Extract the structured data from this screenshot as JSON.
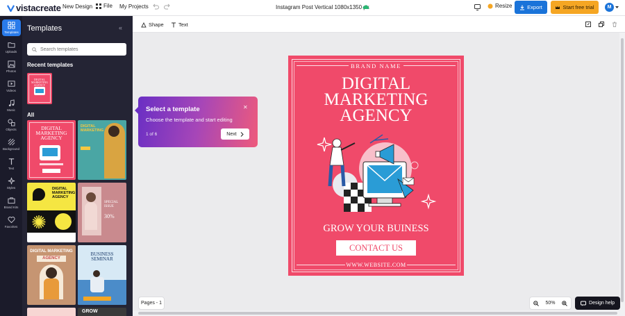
{
  "topbar": {
    "logo": "vistacreate",
    "new_design": "New Design",
    "file": "File",
    "my_projects": "My Projects",
    "doc_title": "Instagram Post Vertical 1080x1350 px",
    "resize": "Resize",
    "export": "Export",
    "start_trial": "Start free trial",
    "avatar": "M"
  },
  "rail": {
    "items": [
      {
        "label": "Templates",
        "icon": "grid-icon"
      },
      {
        "label": "Uploads",
        "icon": "folder-icon"
      },
      {
        "label": "Photos",
        "icon": "image-icon"
      },
      {
        "label": "Videos",
        "icon": "video-icon"
      },
      {
        "label": "Music",
        "icon": "music-icon"
      },
      {
        "label": "Objects",
        "icon": "shapes-icon"
      },
      {
        "label": "Background",
        "icon": "background-icon"
      },
      {
        "label": "Text",
        "icon": "text-icon"
      },
      {
        "label": "Styles",
        "icon": "sparkle-icon"
      },
      {
        "label": "Brand Kits",
        "icon": "briefcase-icon"
      },
      {
        "label": "Favorites",
        "icon": "heart-icon"
      }
    ]
  },
  "panel": {
    "title": "Templates",
    "search_placeholder": "Search templates",
    "recent_heading": "Recent templates",
    "all_heading": "All"
  },
  "thumbs": {
    "t1_title": "DIGITAL MARKETING AGENCY",
    "t2_title": "DIGITAL MARKETING",
    "t3_title": "DIGITAL MARKETING AGENCY",
    "t4_title": "SPECIAL ISSUE",
    "t4_offer": "30%",
    "t5_title": "DIGITAL MARKETING",
    "t5_sub": "AGENCY",
    "t6_title": "BUSINESS SEMINAR",
    "t7_title": "GROW"
  },
  "toolbar": {
    "shape": "Shape",
    "text": "Text"
  },
  "poster": {
    "brand": "BRAND NAME",
    "title_1": "DIGITAL",
    "title_2": "MARKETING",
    "title_3": "AGENCY",
    "grow": "GROW YOUR BUINESS",
    "contact": "CONTACT US",
    "website": "WWW.WEBSITE.COM"
  },
  "tooltip": {
    "title": "Select a template",
    "desc": "Choose the template and start editing",
    "step": "1 of 6",
    "next": "Next"
  },
  "bottom": {
    "pages": "Pages - 1",
    "zoom": "50%",
    "help": "Design help"
  },
  "colors": {
    "accent": "#1a73d9",
    "trial": "#f5a623",
    "poster_bg": "#f04a6a"
  }
}
